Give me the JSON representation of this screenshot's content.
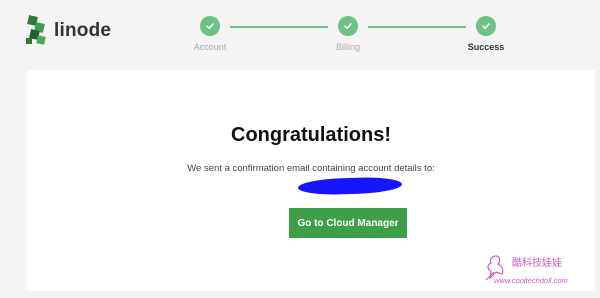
{
  "brand": {
    "name": "linode"
  },
  "steps": [
    {
      "label": "Account",
      "state": "complete"
    },
    {
      "label": "Billing",
      "state": "complete"
    },
    {
      "label": "Success",
      "state": "current"
    }
  ],
  "colors": {
    "step": "#6bc283",
    "button": "#3e9f48",
    "logo": "#2d7a3b",
    "redaction": "#1515ff",
    "watermark": "#cc5cc8"
  },
  "main": {
    "title": "Congratulations!",
    "message": "We sent a confirmation email containing account details to:",
    "button_label": "Go to Cloud Manager"
  },
  "watermark": {
    "line1": "酷科技娃娃",
    "line2": "www.cooltechdoll.com"
  }
}
